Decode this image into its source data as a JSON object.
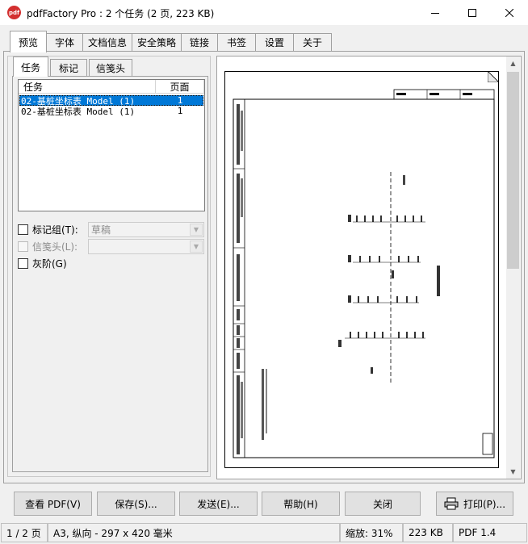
{
  "window": {
    "app_icon": "pdf",
    "title": "pdfFactory Pro : 2 个任务 (2 页, 223 KB)",
    "min_icon": "minimize-icon",
    "max_icon": "maximize-icon",
    "close_icon": "close-icon"
  },
  "tabs": [
    "预览",
    "字体",
    "文档信息",
    "安全策略",
    "链接",
    "书签",
    "设置",
    "关于"
  ],
  "subtabs": [
    "任务",
    "标记",
    "信笺头"
  ],
  "job_list": {
    "headers": [
      "任务",
      "页面"
    ],
    "rows": [
      {
        "name": "02-基桩坐标表 Model (1)",
        "pages": "1",
        "selected": true
      },
      {
        "name": "02-基桩坐标表 Model (1)",
        "pages": "1",
        "selected": false
      }
    ]
  },
  "options": {
    "markup_group_label": "标记组(T):",
    "markup_group_value": "草稿",
    "letterhead_label": "信笺头(L):",
    "letterhead_value": "",
    "grayscale_label": "灰阶(G)"
  },
  "buttons": [
    "查看 PDF(V)",
    "保存(S)...",
    "发送(E)...",
    "帮助(H)",
    "关闭",
    "打印(P)..."
  ],
  "status": {
    "page": "1 / 2 页",
    "paper": "A3, 纵向 - 297 x 420 毫米",
    "zoom": "缩放: 31%",
    "size": "223 KB",
    "pdf_version": "PDF 1.4"
  },
  "colors": {
    "selection": "#0078d7",
    "icon_red": "#d32f2f"
  }
}
